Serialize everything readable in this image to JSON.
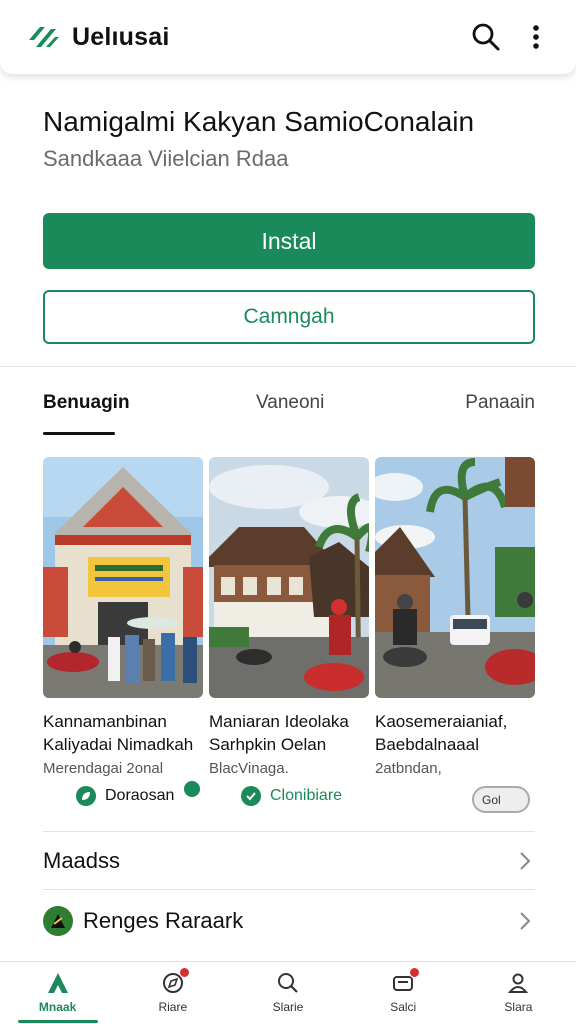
{
  "app_bar": {
    "app_name": "Uelıusai",
    "logo_icon": "app-logo-slashes-icon",
    "search_icon": "search-icon",
    "more_icon": "more-vertical-icon"
  },
  "listing": {
    "title": "Namigalmi Kakyan SamioConalain",
    "subtitle": "Sandkaaa Viielcian Rdaa"
  },
  "actions": {
    "install_label": "Instal",
    "secondary_label": "Camngah"
  },
  "tabs": [
    {
      "label": "Benuagin",
      "active": true
    },
    {
      "label": "Vaneoni",
      "active": false
    },
    {
      "label": "Panaain",
      "active": false
    }
  ],
  "cards": [
    {
      "title_line1": "Kannamanbinan",
      "title_line2": "Kaliyadai Nimadkah",
      "subtitle": "Merendagai 2onal"
    },
    {
      "title_line1": "Maniaran Ideolaka",
      "title_line2": "Sarhpkin Oelan",
      "subtitle": "BlacVinaga."
    },
    {
      "title_line1": "Kaosemeraianiaf,",
      "title_line2": "Baebdalnaaal",
      "subtitle": "2atbndan,"
    }
  ],
  "chips": [
    {
      "label": "Doraosan",
      "icon": "leaf-badge-icon"
    },
    {
      "label": "Clonibiare",
      "icon": "check-badge-icon"
    },
    {
      "label": "Gol",
      "icon": "toggle-switch-icon"
    }
  ],
  "list_rows": [
    {
      "label": "Maadss"
    },
    {
      "label": "Renges Raraark"
    }
  ],
  "bottom_nav": [
    {
      "label": "Mnaak",
      "icon": "home-icon",
      "active": true,
      "badge": false
    },
    {
      "label": "Riare",
      "icon": "explore-icon",
      "active": false,
      "badge": true
    },
    {
      "label": "Slarie",
      "icon": "search-icon",
      "active": false,
      "badge": false
    },
    {
      "label": "Salci",
      "icon": "inbox-icon",
      "active": false,
      "badge": true
    },
    {
      "label": "Slara",
      "icon": "profile-icon",
      "active": false,
      "badge": false
    }
  ],
  "colors": {
    "accent": "#1b8a5a",
    "badge": "#d32f2f",
    "text_primary": "#111111",
    "text_secondary": "#6b6b6b"
  }
}
